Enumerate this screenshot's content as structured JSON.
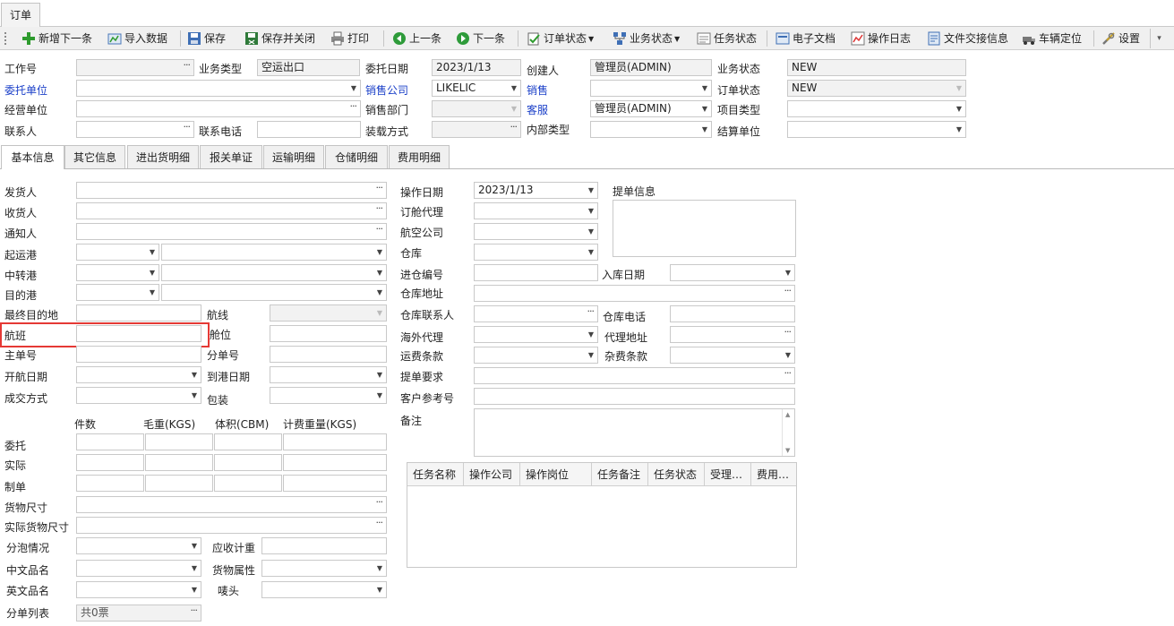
{
  "window": {
    "doc_tab": "订单"
  },
  "toolbar": {
    "items": [
      {
        "label": "新增下一条",
        "icon": "add-icon"
      },
      {
        "label": "导入数据",
        "icon": "import-icon"
      },
      {
        "label": "保存",
        "icon": "save-icon"
      },
      {
        "label": "保存并关闭",
        "icon": "save-close-icon"
      },
      {
        "label": "打印",
        "icon": "print-icon"
      },
      {
        "label": "上一条",
        "icon": "previous-icon"
      },
      {
        "label": "下一条",
        "icon": "next-icon"
      },
      {
        "label": "订单状态",
        "icon": "order-status-icon"
      },
      {
        "label": "业务状态",
        "icon": "business-status-icon"
      },
      {
        "label": "任务状态",
        "icon": "task-status-icon"
      },
      {
        "label": "电子文档",
        "icon": "document-icon"
      },
      {
        "label": "操作日志",
        "icon": "log-icon"
      },
      {
        "label": "文件交接信息",
        "icon": "handover-icon"
      },
      {
        "label": "车辆定位",
        "icon": "vehicle-icon"
      },
      {
        "label": "设置",
        "icon": "settings-icon"
      }
    ]
  },
  "header": {
    "job_no_label": "工作号",
    "job_no_value": "",
    "biz_type_label": "业务类型",
    "biz_type_value": "空运出口",
    "entrust_date_label": "委托日期",
    "entrust_date_value": "2023/1/13",
    "creator_label": "创建人",
    "creator_value": "管理员(ADMIN)",
    "biz_status_label": "业务状态",
    "biz_status_value": "NEW",
    "client_label": "委托单位",
    "client_value": "",
    "sales_company_label": "销售公司",
    "sales_company_value": "LIKELIC",
    "sales_label": "销售",
    "sales_value": "",
    "order_status_label": "订单状态",
    "order_status_value": "NEW",
    "operating_unit_label": "经营单位",
    "operating_unit_value": "",
    "sales_dept_label": "销售部门",
    "sales_dept_value": "",
    "cs_label": "客服",
    "cs_value": "管理员(ADMIN)",
    "project_type_label": "项目类型",
    "project_type_value": "",
    "contact_label": "联系人",
    "contact_value": "",
    "phone_label": "联系电话",
    "phone_value": "",
    "loading_label": "装载方式",
    "loading_value": "",
    "internal_type_label": "内部类型",
    "internal_type_value": "",
    "settle_unit_label": "结算单位",
    "settle_unit_value": ""
  },
  "tabs": [
    "基本信息",
    "其它信息",
    "进出货明细",
    "报关单证",
    "运输明细",
    "仓储明细",
    "费用明细"
  ],
  "basic": {
    "shipper": "发货人",
    "consignee": "收货人",
    "notify": "通知人",
    "pol": "起运港",
    "transit": "中转港",
    "pod": "目的港",
    "final_dest": "最终目的地",
    "route": "航线",
    "flight": "航班",
    "space": "舱位",
    "mawb": "主单号",
    "hawb": "分单号",
    "etd": "开航日期",
    "eta": "到港日期",
    "deal_mode": "成交方式",
    "packing": "包装",
    "qty_col": "件数",
    "gw_col": "毛重(KGS)",
    "vol_col": "体积(CBM)",
    "cw_col": "计费重量(KGS)",
    "row_entrust": "委托",
    "row_actual": "实际",
    "row_doc": "制单",
    "cargo_size": "货物尺寸",
    "actual_cargo_size": "实际货物尺寸",
    "split": "分泡情况",
    "recv_weight": "应收计重",
    "cn_name": "中文品名",
    "cargo_attr": "货物属性",
    "en_name": "英文品名",
    "mark": "唛头",
    "sub_list": "分单列表",
    "sub_list_value": "共0票"
  },
  "middle": {
    "op_date": "操作日期",
    "op_date_value": "2023/1/13",
    "booking_agent": "订舱代理",
    "airline": "航空公司",
    "warehouse": "仓库",
    "entry_no": "进仓编号",
    "entry_date": "入库日期",
    "wh_address": "仓库地址",
    "wh_contact": "仓库联系人",
    "wh_phone": "仓库电话",
    "overseas_agent": "海外代理",
    "agent_address": "代理地址",
    "freight_terms": "运费条款",
    "misc_terms": "杂费条款",
    "bl_req": "提单要求",
    "cust_ref": "客户参考号",
    "remark": "备注",
    "bl_info": "提单信息"
  },
  "task_grid": {
    "columns": [
      "任务名称",
      "操作公司",
      "操作岗位",
      "任务备注",
      "任务状态",
      "受理…",
      "费用…"
    ],
    "rows": []
  }
}
